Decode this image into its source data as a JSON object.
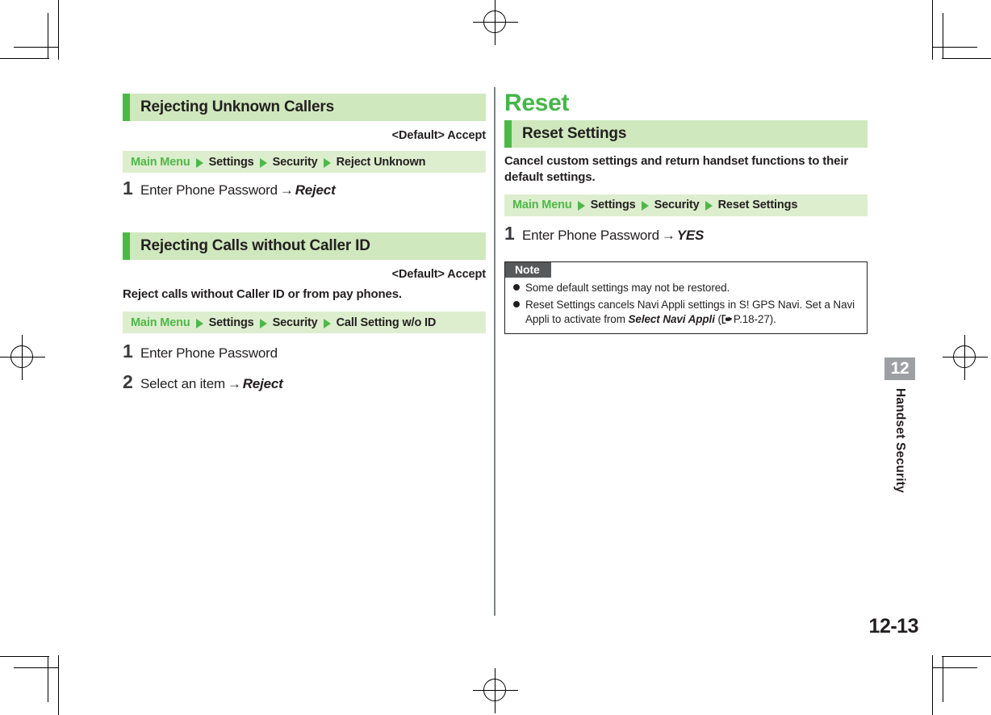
{
  "document": {
    "folio": "12-13",
    "side_tab": {
      "number": "12",
      "label": "Handset Security"
    }
  },
  "symbols": {
    "path_arrow": "green-triangle-right",
    "step_arrow": "→",
    "reference_icon": "pointing-hand-reference-icon"
  },
  "colors": {
    "accent_green": "#4cb848",
    "section_bar_bg": "#cfe8bd",
    "path_bar_bg": "#ddeece",
    "note_badge_bg": "#58595b",
    "tab_number_bg": "#9d9fa2",
    "text": "#231f20",
    "rule": "#808285"
  },
  "left_column": {
    "sections": [
      {
        "heading": "Rejecting Unknown Callers",
        "default_line": "<Default> Accept",
        "lead": "",
        "path": {
          "root": "Main Menu",
          "crumbs": [
            "Settings",
            "Security",
            "Reject Unknown"
          ]
        },
        "steps": [
          {
            "number": "1",
            "text": "Enter Phone Password",
            "arrow": "→",
            "operand": "Reject"
          }
        ]
      },
      {
        "heading": "Rejecting Calls without Caller ID",
        "default_line": "<Default> Accept",
        "lead": "Reject calls without Caller ID or from pay phones.",
        "path": {
          "root": "Main Menu",
          "crumbs": [
            "Settings",
            "Security",
            "Call Setting w/o ID"
          ]
        },
        "steps": [
          {
            "number": "1",
            "text": "Enter Phone Password",
            "arrow": "",
            "operand": ""
          },
          {
            "number": "2",
            "text": "Select an item",
            "arrow": "→",
            "operand": "Reject"
          }
        ]
      }
    ]
  },
  "right_column": {
    "chapter_title": "Reset",
    "sections": [
      {
        "heading": "Reset Settings",
        "default_line": "",
        "lead": "Cancel custom settings and return handset functions to their default settings.",
        "path": {
          "root": "Main Menu",
          "crumbs": [
            "Settings",
            "Security",
            "Reset Settings"
          ]
        },
        "steps": [
          {
            "number": "1",
            "text": "Enter Phone Password",
            "arrow": "→",
            "operand": "YES"
          }
        ]
      }
    ],
    "note": {
      "badge": "Note",
      "items": [
        {
          "part1": "Some default settings may not be restored.",
          "emphasis": "",
          "part2": "",
          "reference": ""
        },
        {
          "part1": "Reset Settings cancels Navi Appli settings in S! GPS Navi. Set a Navi Appli to activate from ",
          "emphasis": "Select Navi Appli",
          "part2": " (",
          "reference": "P.18-27)."
        }
      ]
    }
  }
}
